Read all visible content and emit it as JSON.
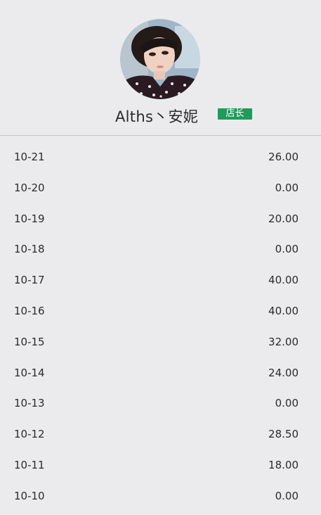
{
  "profile": {
    "name": "Alths丶安妮",
    "role": "店长"
  },
  "records": [
    {
      "date": "10-21",
      "amount": "26.00"
    },
    {
      "date": "10-20",
      "amount": "0.00"
    },
    {
      "date": "10-19",
      "amount": "20.00"
    },
    {
      "date": "10-18",
      "amount": "0.00"
    },
    {
      "date": "10-17",
      "amount": "40.00"
    },
    {
      "date": "10-16",
      "amount": "40.00"
    },
    {
      "date": "10-15",
      "amount": "32.00"
    },
    {
      "date": "10-14",
      "amount": "24.00"
    },
    {
      "date": "10-13",
      "amount": "0.00"
    },
    {
      "date": "10-12",
      "amount": "28.50"
    },
    {
      "date": "10-11",
      "amount": "18.00"
    },
    {
      "date": "10-10",
      "amount": "0.00"
    }
  ],
  "colors": {
    "background": "#ebebed",
    "badge": "#1f9c5a",
    "divider": "#c6c6c8"
  }
}
